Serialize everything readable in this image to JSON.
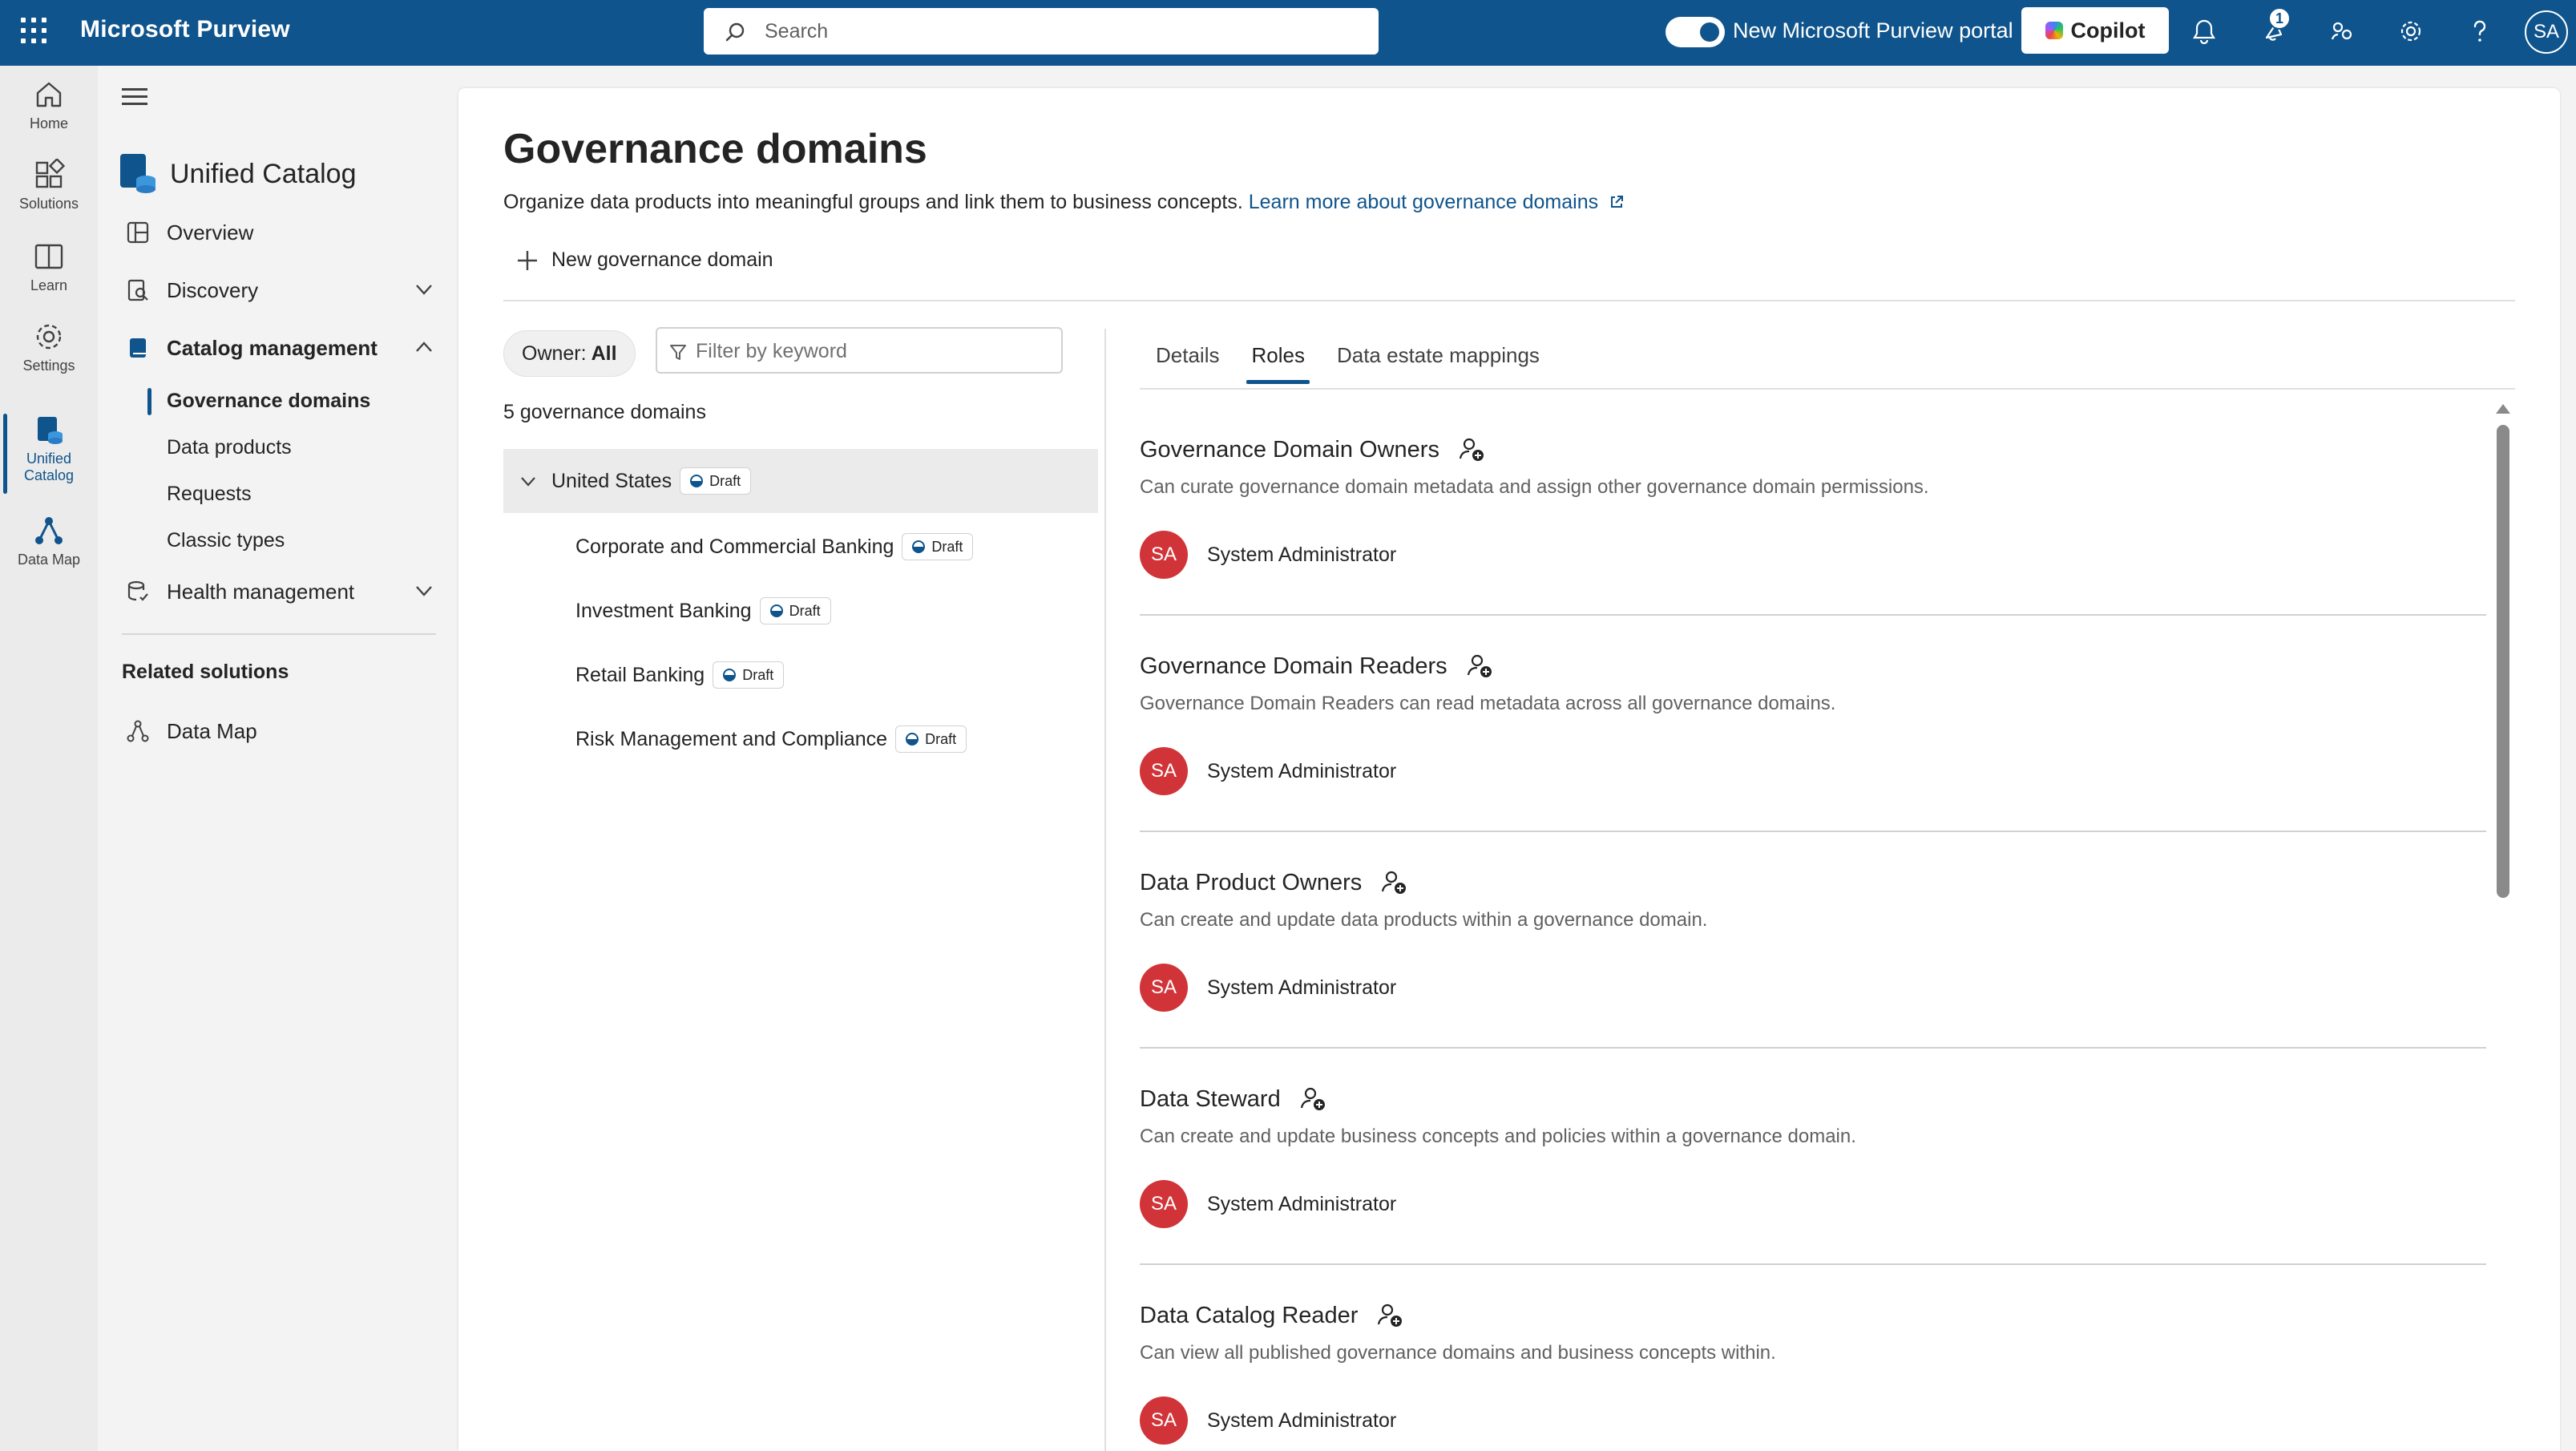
{
  "topbar": {
    "app_title": "Microsoft Purview",
    "search_placeholder": "Search",
    "toggle_label": "New Microsoft Purview portal",
    "copilot_label": "Copilot",
    "notification_count": "1",
    "user_initials": "SA",
    "colors": {
      "bar": "#0f548c"
    }
  },
  "rail": {
    "items": [
      {
        "label": "Home",
        "icon": "home-icon"
      },
      {
        "label": "Solutions",
        "icon": "solutions-icon"
      },
      {
        "label": "Learn",
        "icon": "book-icon"
      },
      {
        "label": "Settings",
        "icon": "gear-icon"
      },
      {
        "label": "Unified Catalog",
        "icon": "catalog-icon",
        "active": true
      },
      {
        "label": "Data Map",
        "icon": "data-map-icon"
      }
    ]
  },
  "nav": {
    "title": "Unified Catalog",
    "items": [
      {
        "label": "Overview",
        "icon": "overview-icon"
      },
      {
        "label": "Discovery",
        "icon": "discovery-icon",
        "expandable": true
      },
      {
        "label": "Catalog management",
        "icon": "catalog-management-icon",
        "expanded": true
      },
      {
        "label": "Health management",
        "icon": "health-icon",
        "expandable": true
      }
    ],
    "catalog_management_children": [
      "Governance domains",
      "Data products",
      "Requests",
      "Classic types"
    ],
    "related_heading": "Related solutions",
    "related_items": [
      {
        "label": "Data Map",
        "icon": "data-map-icon"
      }
    ]
  },
  "page": {
    "title": "Governance domains",
    "description": "Organize data products into meaningful groups and link them to business concepts.",
    "learn_more": "Learn more about governance domains",
    "new_button": "New governance domain",
    "owner_filter_label": "Owner:",
    "owner_filter_value": "All",
    "keyword_placeholder": "Filter by keyword",
    "count_text": "5 governance domains"
  },
  "domains": {
    "root": {
      "name": "United States",
      "status": "Draft"
    },
    "children": [
      {
        "name": "Corporate and Commercial Banking",
        "status": "Draft"
      },
      {
        "name": "Investment Banking",
        "status": "Draft"
      },
      {
        "name": "Retail Banking",
        "status": "Draft"
      },
      {
        "name": "Risk Management and Compliance",
        "status": "Draft"
      }
    ]
  },
  "detail_tabs": [
    {
      "label": "Details"
    },
    {
      "label": "Roles",
      "active": true
    },
    {
      "label": "Data estate mappings"
    }
  ],
  "roles": [
    {
      "title": "Governance Domain Owners",
      "description": "Can curate governance domain metadata and assign other governance domain permissions.",
      "member": "System Administrator",
      "initials": "SA"
    },
    {
      "title": "Governance Domain Readers",
      "description": "Governance Domain Readers can read metadata across all governance domains.",
      "member": "System Administrator",
      "initials": "SA"
    },
    {
      "title": "Data Product Owners",
      "description": "Can create and update data products within a governance domain.",
      "member": "System Administrator",
      "initials": "SA"
    },
    {
      "title": "Data Steward",
      "description": "Can create and update business concepts and policies within a governance domain.",
      "member": "System Administrator",
      "initials": "SA"
    },
    {
      "title": "Data Catalog Reader",
      "description": "Can view all published governance domains and business concepts within.",
      "member": "System Administrator",
      "initials": "SA"
    }
  ],
  "colors": {
    "accent": "#0f548c",
    "avatar": "#d13438",
    "selected_row": "#ebebeb"
  }
}
